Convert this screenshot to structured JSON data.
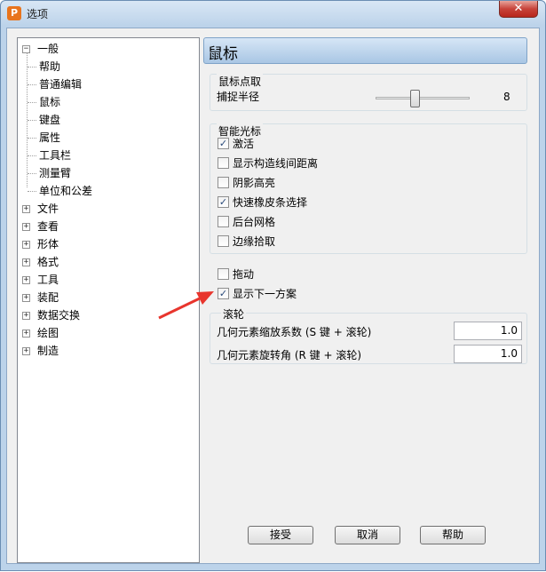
{
  "window": {
    "title": "选项",
    "app_icon_glyph": "P",
    "close_glyph": "✕"
  },
  "tree": {
    "general": {
      "label": "一般",
      "expander": "−",
      "children": [
        "帮助",
        "普通编辑",
        "鼠标",
        "键盘",
        "属性",
        "工具栏",
        "测量臂",
        "单位和公差"
      ],
      "selected": "鼠标"
    },
    "others": [
      "文件",
      "查看",
      "形体",
      "格式",
      "工具",
      "装配",
      "数据交换",
      "绘图",
      "制造"
    ],
    "expander_collapsed": "+"
  },
  "panel": {
    "title": "鼠标",
    "pick_group": {
      "title": "鼠标点取",
      "radius_label": "捕捉半径",
      "radius_value": "8"
    },
    "smart_group": {
      "title": "智能光标",
      "options": [
        {
          "label": "激活",
          "checked": true
        },
        {
          "label": "显示构造线间距离",
          "checked": false
        },
        {
          "label": "阴影高亮",
          "checked": false
        },
        {
          "label": "快速橡皮条选择",
          "checked": true
        },
        {
          "label": "后台网格",
          "checked": false
        },
        {
          "label": "边缘拾取",
          "checked": false
        }
      ]
    },
    "drag": {
      "label": "拖动",
      "checked": false
    },
    "show_next": {
      "label": "显示下一方案",
      "checked": true
    },
    "wheel_group": {
      "title": "滚轮",
      "zoom_label": "几何元素缩放系数 (S 键 + 滚轮)",
      "zoom_value": "1.0",
      "rotate_label": "几何元素旋转角 (R 键 + 滚轮)",
      "rotate_value": "1.0"
    }
  },
  "buttons": {
    "ok": "接受",
    "cancel": "取消",
    "help": "帮助"
  },
  "colors": {
    "annotation_arrow": "#e8352d",
    "selection_text": "#000000"
  }
}
